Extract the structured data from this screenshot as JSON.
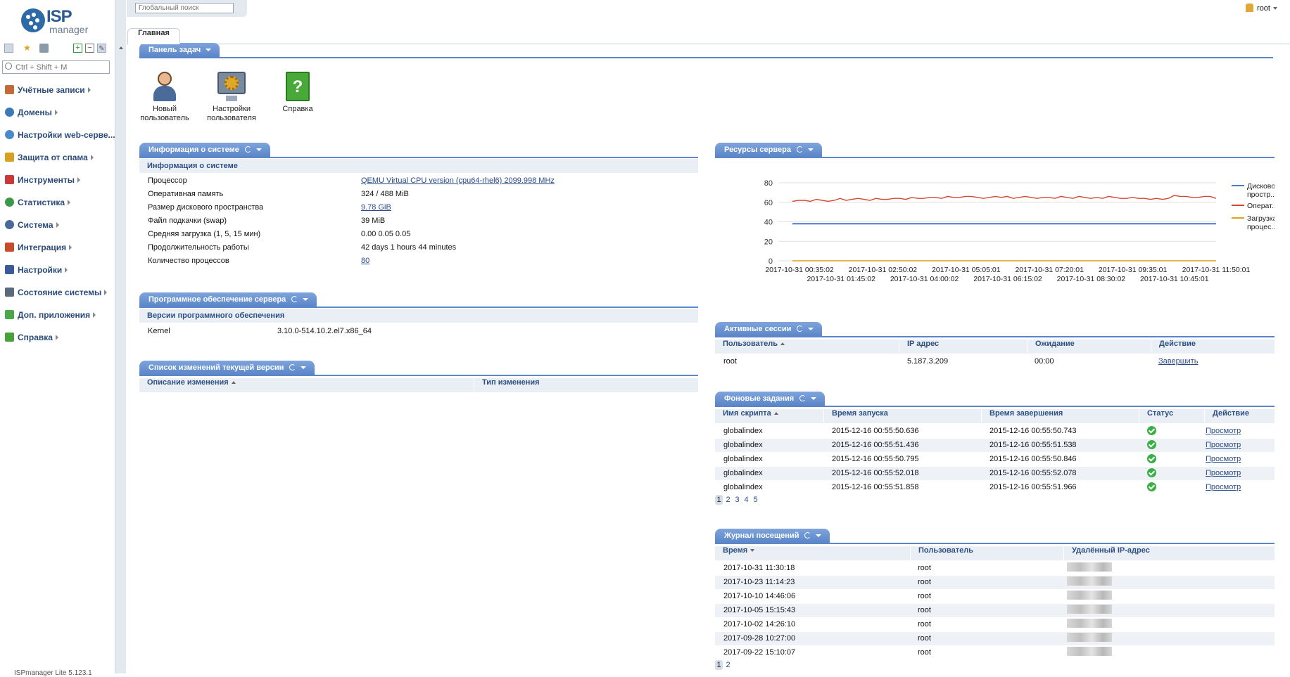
{
  "brand": {
    "logo_text": "ISP",
    "logo_sub": "manager"
  },
  "sidebar": {
    "search_placeholder": "Ctrl + Shift + M",
    "items": [
      {
        "label": "Учётные записи",
        "color": "#c46a3a"
      },
      {
        "label": "Домены",
        "color": "#3a7ab8"
      },
      {
        "label": "Настройки web-серве...",
        "color": "#4a8ac8"
      },
      {
        "label": "Защита от спама",
        "color": "#d8a020"
      },
      {
        "label": "Инструменты",
        "color": "#c83a3a"
      },
      {
        "label": "Статистика",
        "color": "#3a9a48"
      },
      {
        "label": "Система",
        "color": "#4a6a9a"
      },
      {
        "label": "Интеграция",
        "color": "#c84a2a"
      },
      {
        "label": "Настройки",
        "color": "#3a5a9a"
      },
      {
        "label": "Состояние системы",
        "color": "#5a6a7a"
      },
      {
        "label": "Доп. приложения",
        "color": "#4aa848"
      },
      {
        "label": "Справка",
        "color": "#48a038"
      }
    ],
    "footer": "ISPmanager Lite 5.123.1"
  },
  "topbar": {
    "global_search_placeholder": "Глобальный поиск",
    "user": "root"
  },
  "tabs": {
    "main": "Главная"
  },
  "taskpanel": {
    "title": "Панель задач",
    "items": [
      {
        "line1": "Новый",
        "line2": "пользователь"
      },
      {
        "line1": "Настройки",
        "line2": "пользователя"
      },
      {
        "line1": "Справка",
        "line2": ""
      }
    ]
  },
  "sysinfo": {
    "title": "Информация о системе",
    "subtitle": "Информация о системе",
    "rows": [
      {
        "k": "Процессор",
        "v": "QEMU Virtual CPU version (cpu64-rhel6) 2099.998 MHz"
      },
      {
        "k": "Оперативная память",
        "v": "324 / 488 MiB"
      },
      {
        "k": "Размер дискового пространства",
        "v": "9.78 GiB"
      },
      {
        "k": "Файл подкачки (swap)",
        "v": "39 MiB"
      },
      {
        "k": "Средняя загрузка (1, 5, 15 мин)",
        "v": "0.00 0.05 0.05"
      },
      {
        "k": "Продолжительность работы",
        "v": "42 days 1 hours 44 minutes"
      },
      {
        "k": "Количество процессов",
        "v": "80"
      }
    ]
  },
  "software": {
    "title": "Программное обеспечение сервера",
    "subtitle": "Версии программного обеспечения",
    "rows": [
      {
        "k": "Kernel",
        "v": "3.10.0-514.10.2.el7.x86_64"
      }
    ]
  },
  "changelog": {
    "title": "Список изменений текущей версии",
    "columns": [
      "Описание изменения",
      "Тип изменения"
    ]
  },
  "resources": {
    "title": "Ресурсы сервера",
    "legend": [
      "Дисковое простр...",
      "Операт...",
      "Загрузка процес..."
    ]
  },
  "chart_data": {
    "type": "line",
    "x_ticks_top": [
      "2017-10-31 00:35:02",
      "2017-10-31 02:50:02",
      "2017-10-31 05:05:01",
      "2017-10-31 07:20:01",
      "2017-10-31 09:35:01",
      "2017-10-31 11:50:01"
    ],
    "x_ticks_bottom": [
      "2017-10-31 01:45:02",
      "2017-10-31 04:00:02",
      "2017-10-31 06:15:02",
      "2017-10-31 08:30:02",
      "2017-10-31 10:45:01"
    ],
    "y_ticks": [
      "80",
      "60",
      "40",
      "20",
      "0"
    ],
    "ylim": [
      0,
      80
    ],
    "series": [
      {
        "name": "Дисковое простр...",
        "color": "#4a78c8",
        "values": [
          38,
          38,
          38,
          38,
          38,
          38,
          38,
          38,
          38,
          38,
          38,
          38,
          38,
          38,
          38,
          38,
          38,
          38,
          38,
          38,
          38,
          38,
          38,
          38,
          38,
          38,
          38,
          38,
          38,
          38,
          38,
          38,
          38,
          38,
          38,
          38,
          38,
          38,
          38,
          38,
          38,
          38,
          38,
          38,
          38,
          38,
          38,
          38,
          38,
          38,
          38,
          38,
          38,
          38,
          38,
          38,
          38,
          38,
          38,
          38,
          38,
          38,
          38,
          38,
          38,
          38,
          38,
          38,
          38,
          38,
          38,
          38
        ]
      },
      {
        "name": "Операт...",
        "color": "#d04a30",
        "values": [
          61,
          62,
          62,
          61,
          63,
          62,
          61,
          62,
          64,
          62,
          63,
          64,
          63,
          62,
          64,
          63,
          63,
          64,
          64,
          63,
          65,
          64,
          64,
          65,
          65,
          64,
          66,
          65,
          65,
          66,
          66,
          65,
          64,
          65,
          66,
          65,
          66,
          64,
          65,
          66,
          65,
          64,
          65,
          65,
          64,
          66,
          65,
          64,
          66,
          65,
          64,
          65,
          64,
          66,
          65,
          64,
          64,
          65,
          64,
          64,
          63,
          64,
          63,
          64,
          67,
          66,
          66,
          65,
          65,
          66,
          66,
          64
        ]
      },
      {
        "name": "Загрузка процес...",
        "color": "#e0a020",
        "values": [
          0,
          0,
          0,
          0,
          0,
          0,
          0,
          0,
          0,
          0,
          0,
          0,
          0,
          0,
          0,
          0,
          0,
          0,
          0,
          0,
          0,
          0,
          0,
          0,
          0,
          0,
          0,
          0,
          0,
          0,
          0,
          0,
          0,
          0,
          0,
          0,
          0,
          0,
          0,
          0,
          0,
          0,
          0,
          0,
          0,
          0,
          0,
          0,
          0,
          0,
          0,
          0,
          0,
          0,
          0,
          0,
          0,
          0,
          0,
          0,
          0,
          0,
          0,
          0,
          0,
          0,
          0,
          0,
          0,
          0,
          0,
          0
        ]
      }
    ]
  },
  "sessions": {
    "title": "Активные сессии",
    "columns": [
      "Пользователь",
      "IP адрес",
      "Ожидание",
      "Действие"
    ],
    "rows": [
      {
        "user": "root",
        "ip": "5.187.3.209",
        "wait": "00:00",
        "action": "Завершить"
      }
    ]
  },
  "bgtasks": {
    "title": "Фоновые задания",
    "columns": [
      "Имя скрипта",
      "Время запуска",
      "Время завершения",
      "Статус",
      "Действие"
    ],
    "rows": [
      {
        "name": "globalindex",
        "start": "2015-12-16 00:55:50.636",
        "end": "2015-12-16 00:55:50.743",
        "action": "Просмотр"
      },
      {
        "name": "globalindex",
        "start": "2015-12-16 00:55:51.436",
        "end": "2015-12-16 00:55:51.538",
        "action": "Просмотр"
      },
      {
        "name": "globalindex",
        "start": "2015-12-16 00:55:50.795",
        "end": "2015-12-16 00:55:50.846",
        "action": "Просмотр"
      },
      {
        "name": "globalindex",
        "start": "2015-12-16 00:55:52.018",
        "end": "2015-12-16 00:55:52.078",
        "action": "Просмотр"
      },
      {
        "name": "globalindex",
        "start": "2015-12-16 00:55:51.858",
        "end": "2015-12-16 00:55:51.966",
        "action": "Просмотр"
      }
    ],
    "pages": [
      "1",
      "2",
      "3",
      "4",
      "5"
    ]
  },
  "visits": {
    "title": "Журнал посещений",
    "columns": [
      "Время",
      "Пользователь",
      "Удалённый IP-адрес"
    ],
    "rows": [
      {
        "time": "2017-10-31 11:30:18",
        "user": "root"
      },
      {
        "time": "2017-10-23 11:14:23",
        "user": "root"
      },
      {
        "time": "2017-10-10 14:46:06",
        "user": "root"
      },
      {
        "time": "2017-10-05 15:15:43",
        "user": "root"
      },
      {
        "time": "2017-10-02 14:26:10",
        "user": "root"
      },
      {
        "time": "2017-09-28 10:27:00",
        "user": "root"
      },
      {
        "time": "2017-09-22 15:10:07",
        "user": "root"
      }
    ],
    "pages": [
      "1",
      "2"
    ]
  }
}
